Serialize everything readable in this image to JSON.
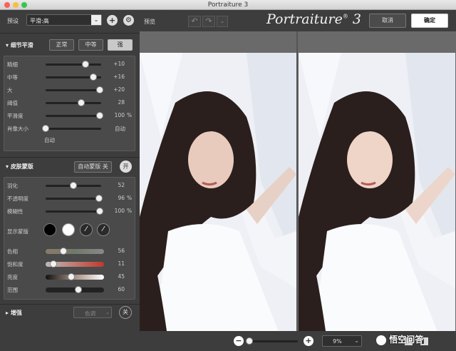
{
  "window": {
    "title": "Portraiture 3"
  },
  "preset": {
    "label": "预设",
    "value": "平滑:高"
  },
  "toolbar": {
    "preview_label": "预览",
    "logo_text": "Portraiture",
    "logo_version": "3",
    "cancel_label": "取消",
    "ok_label": "确定"
  },
  "detail_smoothing": {
    "title": "细节平滑",
    "modes": [
      "正常",
      "中等",
      "强"
    ],
    "sliders": [
      {
        "label": "精细",
        "value": "+10",
        "level": 0.72
      },
      {
        "label": "中等",
        "value": "+16",
        "level": 0.86
      },
      {
        "label": "大",
        "value": "+20",
        "level": 0.97
      },
      {
        "label": "阈值",
        "value": "28",
        "level": 0.64
      },
      {
        "label": "平滑度",
        "value": "100",
        "unit": "%",
        "level": 0.97
      }
    ],
    "portrait_size": {
      "label": "肖像大小",
      "value": "自动",
      "sublabel": "自动",
      "level": 0.0
    }
  },
  "skin_mask": {
    "title": "皮肤蒙版",
    "auto_mask_label": "自动蒙版 关",
    "on_label": "开",
    "sliders": [
      {
        "label": "羽化",
        "value": "52",
        "level": 0.5
      },
      {
        "label": "不透明度",
        "value": "96",
        "unit": "%",
        "level": 0.96
      },
      {
        "label": "模糊性",
        "value": "100",
        "unit": "%",
        "level": 0.97
      }
    ],
    "show_mask_label": "显示蒙版",
    "color_sliders": [
      {
        "label": "色相",
        "value": "56",
        "level": 0.3
      },
      {
        "label": "饱和度",
        "value": "11",
        "level": 0.13
      },
      {
        "label": "亮度",
        "value": "45",
        "level": 0.44
      },
      {
        "label": "范围",
        "value": "60",
        "level": 0.56
      }
    ]
  },
  "enhance": {
    "title": "增强",
    "tone_label": "色调",
    "off_label": "关"
  },
  "zoom": {
    "value": "9%"
  },
  "watermark": {
    "text": "悟空问答"
  },
  "colors": {
    "accent": "#c0392b",
    "panel": "#3d3d3d",
    "group": "#4a4a4a"
  }
}
